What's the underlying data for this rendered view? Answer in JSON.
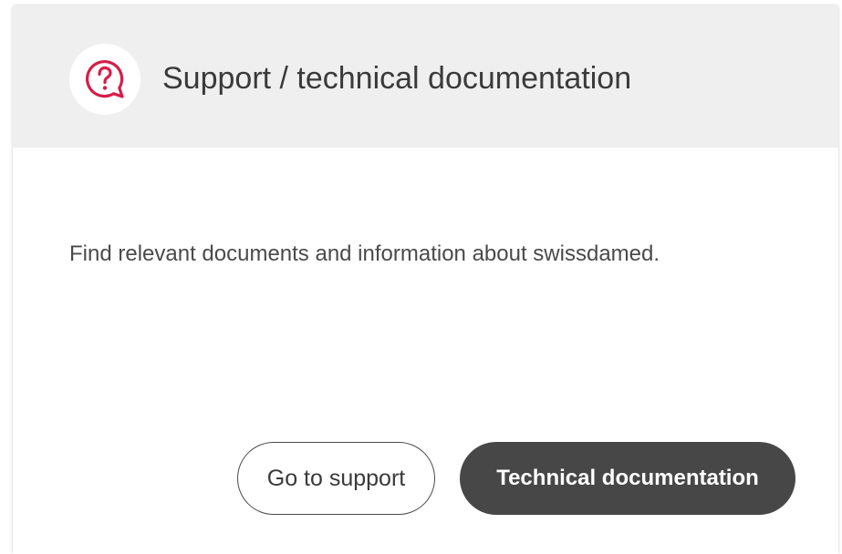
{
  "card": {
    "title": "Support / technical documentation",
    "icon": "question-speech-bubble-icon",
    "description": "Find relevant documents and information about swissdamed.",
    "buttons": {
      "support_label": "Go to support",
      "docs_label": "Technical documentation"
    }
  },
  "colors": {
    "accent": "#d71e48",
    "header_bg": "#efefef",
    "primary_button_bg": "#474747"
  }
}
